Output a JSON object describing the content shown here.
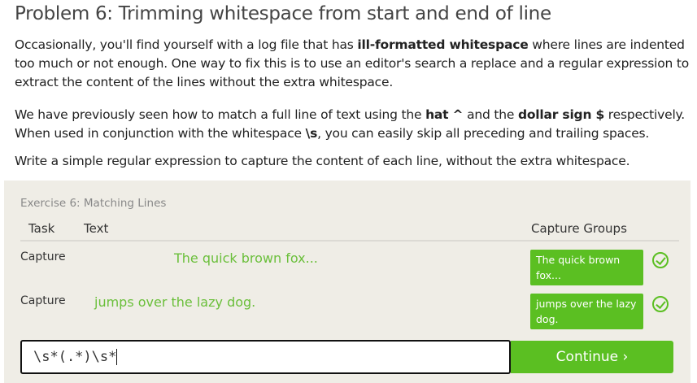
{
  "title": "Problem 6: Trimming whitespace from start and end of line",
  "para1": {
    "pre": "Occasionally, you'll find yourself with a log file that has ",
    "bold": "ill-formatted whitespace",
    "post": " where lines are indented too much or not enough. One way to fix this is to use an editor's search a replace and a regular expression to extract the content of the lines without the extra whitespace."
  },
  "para2": {
    "a": "We have previously seen how to match a full line of text using the ",
    "b1": "hat ^",
    "c": " and the ",
    "b2": "dollar sign $",
    "d": " respectively. When used in conjunction with the whitespace ",
    "b3": "\\s",
    "e": ", you can easily skip all preceding and trailing spaces."
  },
  "para3": "Write a simple regular expression to capture the content of each line, without the extra whitespace.",
  "exercise": {
    "title": "Exercise 6: Matching Lines",
    "headers": {
      "task": "Task",
      "text": "Text",
      "groups": "Capture Groups"
    },
    "rows": [
      {
        "task": "Capture",
        "text": "The quick brown fox...",
        "group": "The quick brown fox..."
      },
      {
        "task": "Capture",
        "text": "jumps over the lazy dog.",
        "group": "jumps over the lazy dog."
      }
    ],
    "input": "\\s*(.*)\\s*",
    "button": "Continue ›"
  },
  "colors": {
    "accent": "#5bbf22",
    "panel": "#efede6"
  }
}
